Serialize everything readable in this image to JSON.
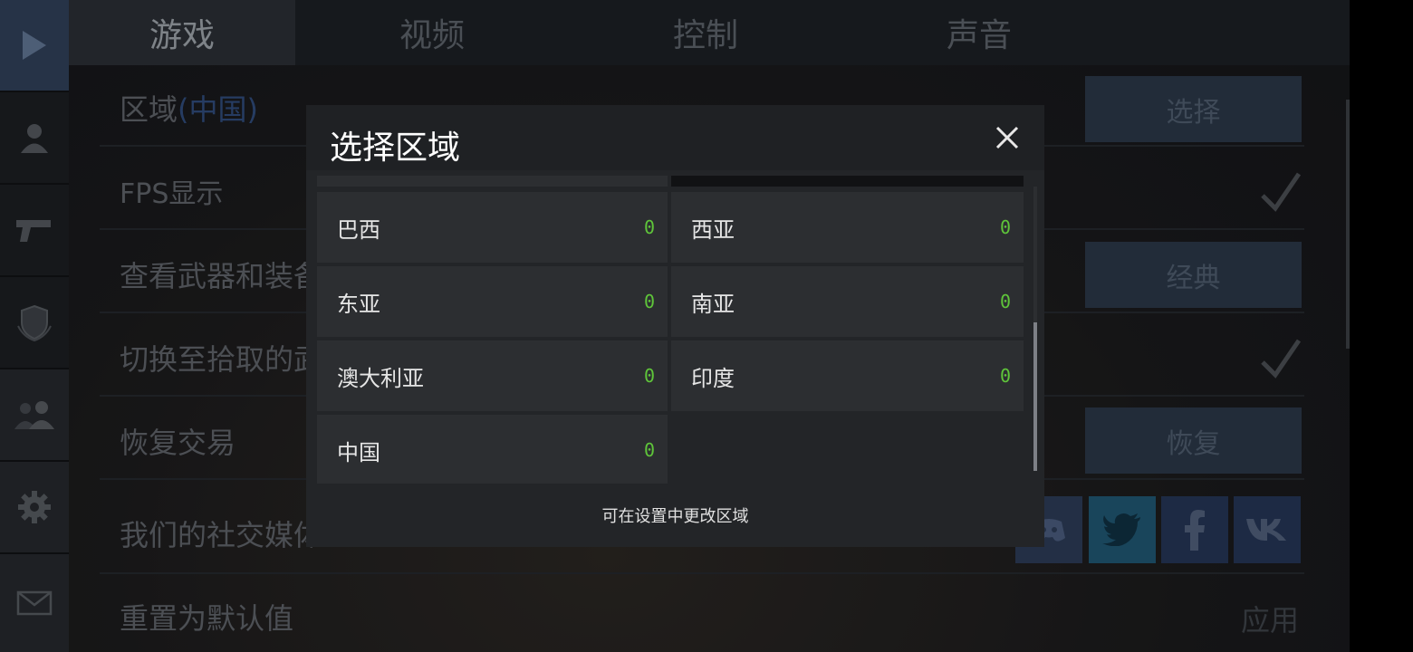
{
  "tabs": [
    {
      "label": "游戏"
    },
    {
      "label": "视频"
    },
    {
      "label": "控制"
    },
    {
      "label": "声音"
    }
  ],
  "settings": {
    "region_label": "区域",
    "region_value": "(中国)",
    "region_button": "选择",
    "fps_label": "FPS显示",
    "weapons_label": "查看武器和装备",
    "weapons_button": "经典",
    "switch_label": "切换至拾取的武器",
    "restore_label": "恢复交易",
    "restore_button": "恢复",
    "social_label": "我们的社交媒体",
    "reset_label": "重置为默认值",
    "apply_label": "应用"
  },
  "modal": {
    "title": "选择区域",
    "note": "可在设置中更改区域",
    "regions": [
      {
        "name": "巴西",
        "ping": "0"
      },
      {
        "name": "西亚",
        "ping": "0"
      },
      {
        "name": "东亚",
        "ping": "0"
      },
      {
        "name": "南亚",
        "ping": "0"
      },
      {
        "name": "澳大利亚",
        "ping": "0"
      },
      {
        "name": "印度",
        "ping": "0"
      },
      {
        "name": "中国",
        "ping": "0"
      }
    ]
  },
  "colors": {
    "ping_green": "#5fc53a",
    "active_sidebar": "#2f3f57",
    "button_bg": "#2a3646"
  }
}
